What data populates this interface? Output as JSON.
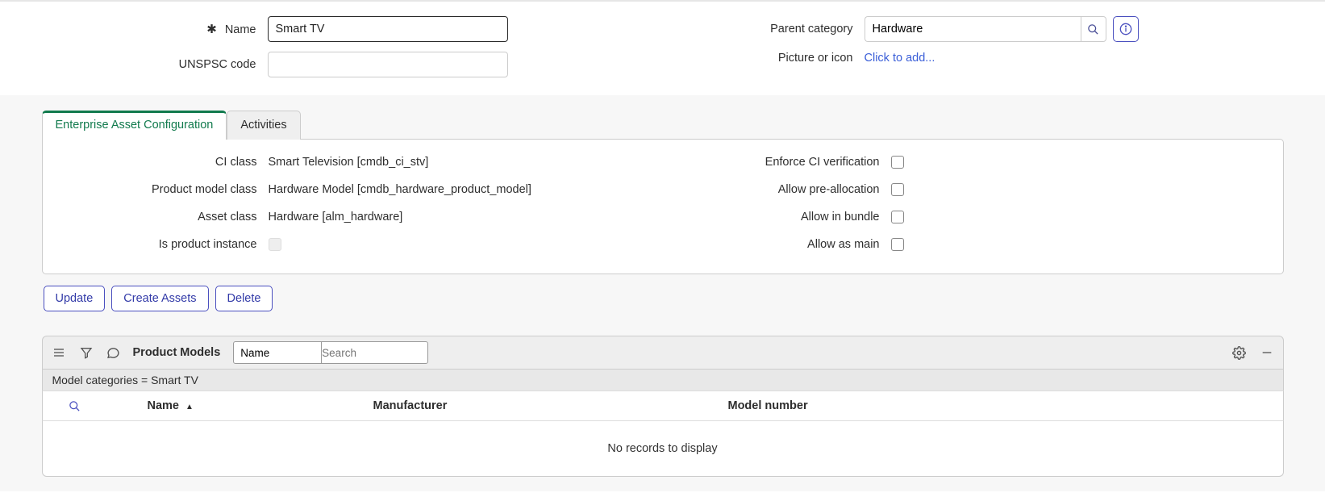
{
  "top": {
    "name_label": "Name",
    "name_value": "Smart TV",
    "unspsc_label": "UNSPSC code",
    "unspsc_value": "",
    "parent_label": "Parent category",
    "parent_value": "Hardware",
    "picture_label": "Picture or icon",
    "picture_link": "Click to add..."
  },
  "tabs": {
    "active": "Enterprise Asset Configuration",
    "inactive": "Activities"
  },
  "panel": {
    "ci_class_label": "CI class",
    "ci_class_value": "Smart Television [cmdb_ci_stv]",
    "pm_class_label": "Product model class",
    "pm_class_value": "Hardware Model [cmdb_hardware_product_model]",
    "asset_class_label": "Asset class",
    "asset_class_value": "Hardware [alm_hardware]",
    "is_product_instance_label": "Is product instance",
    "enforce_label": "Enforce CI verification",
    "prealloc_label": "Allow pre-allocation",
    "bundle_label": "Allow in bundle",
    "main_label": "Allow as main"
  },
  "actions": {
    "update": "Update",
    "create_assets": "Create Assets",
    "delete": "Delete"
  },
  "list": {
    "title": "Product Models",
    "select_value": "Name",
    "search_placeholder": "Search",
    "filter_text": "Model categories = Smart TV",
    "columns": {
      "name": "Name",
      "manufacturer": "Manufacturer",
      "model_number": "Model number"
    },
    "empty_message": "No records to display"
  }
}
